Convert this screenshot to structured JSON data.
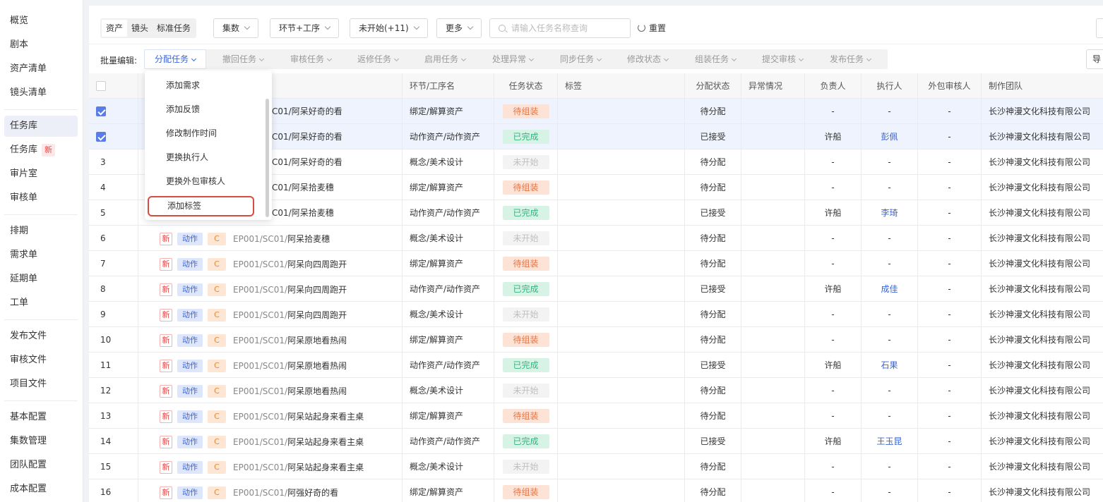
{
  "sidebar": {
    "items": [
      {
        "label": "概览"
      },
      {
        "label": "剧本"
      },
      {
        "label": "资产清单"
      },
      {
        "label": "镜头清单"
      },
      {
        "label": "任务库"
      },
      {
        "label": "任务库",
        "badge": "新"
      },
      {
        "label": "审片室"
      },
      {
        "label": "审核单"
      },
      {
        "label": "排期"
      },
      {
        "label": "需求单"
      },
      {
        "label": "延期单"
      },
      {
        "label": "工单"
      },
      {
        "label": "发布文件"
      },
      {
        "label": "审核文件"
      },
      {
        "label": "项目文件"
      },
      {
        "label": "基本配置"
      },
      {
        "label": "集数管理"
      },
      {
        "label": "团队配置"
      },
      {
        "label": "成本配置"
      }
    ]
  },
  "filters": {
    "segments": [
      "资产",
      "镜头",
      "标准任务"
    ],
    "dropdowns": [
      "集数",
      "环节+工序",
      "未开始(+11)",
      "更多"
    ],
    "search_placeholder": "请输入任务名称查询",
    "reset_label": "重置"
  },
  "batch": {
    "label": "批量编辑:",
    "items": [
      "分配任务",
      "撤回任务",
      "审核任务",
      "返修任务",
      "启用任务",
      "处理异常",
      "同步任务",
      "修改状态",
      "组装任务",
      "提交审核",
      "发布任务"
    ],
    "edge_label": "导"
  },
  "menu": {
    "items": [
      "添加需求",
      "添加反馈",
      "修改制作时间",
      "更换执行人",
      "更换外包审核人",
      "添加标签"
    ]
  },
  "table": {
    "headers": [
      "环节/工序名",
      "任务状态",
      "标签",
      "分配状态",
      "异常情况",
      "负责人",
      "执行人",
      "外包审核人",
      "制作团队"
    ],
    "rows": [
      {
        "idx": "",
        "checked": true,
        "sel": true,
        "path": "C01/阿呆好奇的看",
        "stage": "绑定/解算资产",
        "status": "待组装",
        "skind": "wait",
        "assign": "待分配",
        "owner": "-",
        "exec": "-",
        "review": "-",
        "team": "长沙神漫文化科技有限公司"
      },
      {
        "idx": "",
        "checked": true,
        "sel": true,
        "path": "C01/阿呆好奇的看",
        "stage": "动作资产/动作资产",
        "status": "已完成",
        "skind": "done",
        "assign": "已接受",
        "owner": "许船",
        "exec": "彭佩",
        "review": "-",
        "team": "长沙神漫文化科技有限公司"
      },
      {
        "idx": "3",
        "path": "C01/阿呆好奇的看",
        "stage": "概念/美术设计",
        "status": "未开始",
        "skind": "none",
        "assign": "待分配",
        "owner": "-",
        "exec": "-",
        "review": "-",
        "team": "长沙神漫文化科技有限公司"
      },
      {
        "idx": "4",
        "path": "C01/阿呆拾麦穗",
        "stage": "绑定/解算资产",
        "status": "待组装",
        "skind": "wait",
        "assign": "待分配",
        "owner": "-",
        "exec": "-",
        "review": "-",
        "team": "长沙神漫文化科技有限公司"
      },
      {
        "idx": "5",
        "path": "C01/阿呆拾麦穗",
        "stage": "动作资产/动作资产",
        "status": "已完成",
        "skind": "done",
        "assign": "已接受",
        "owner": "许船",
        "exec": "李琦",
        "review": "-",
        "team": "长沙神漫文化科技有限公司"
      },
      {
        "idx": "6",
        "tags": true,
        "code": "EP001/SC01/",
        "path": "阿呆拾麦穗",
        "stage": "概念/美术设计",
        "status": "未开始",
        "skind": "none",
        "assign": "待分配",
        "owner": "-",
        "exec": "-",
        "review": "-",
        "team": "长沙神漫文化科技有限公司"
      },
      {
        "idx": "7",
        "tags": true,
        "code": "EP001/SC01/",
        "path": "阿呆向四周跑开",
        "stage": "绑定/解算资产",
        "status": "待组装",
        "skind": "wait",
        "assign": "待分配",
        "owner": "-",
        "exec": "-",
        "review": "-",
        "team": "长沙神漫文化科技有限公司"
      },
      {
        "idx": "8",
        "tags": true,
        "code": "EP001/SC01/",
        "path": "阿呆向四周跑开",
        "stage": "动作资产/动作资产",
        "status": "已完成",
        "skind": "done",
        "assign": "已接受",
        "owner": "许船",
        "exec": "成佳",
        "review": "-",
        "team": "长沙神漫文化科技有限公司"
      },
      {
        "idx": "9",
        "tags": true,
        "code": "EP001/SC01/",
        "path": "阿呆向四周跑开",
        "stage": "概念/美术设计",
        "status": "未开始",
        "skind": "none",
        "assign": "待分配",
        "owner": "-",
        "exec": "-",
        "review": "-",
        "team": "长沙神漫文化科技有限公司"
      },
      {
        "idx": "10",
        "tags": true,
        "code": "EP001/SC01/",
        "path": "阿呆原地看热闹",
        "stage": "绑定/解算资产",
        "status": "待组装",
        "skind": "wait",
        "assign": "待分配",
        "owner": "-",
        "exec": "-",
        "review": "-",
        "team": "长沙神漫文化科技有限公司"
      },
      {
        "idx": "11",
        "tags": true,
        "code": "EP001/SC01/",
        "path": "阿呆原地看热闹",
        "stage": "动作资产/动作资产",
        "status": "已完成",
        "skind": "done",
        "assign": "已接受",
        "owner": "许船",
        "exec": "石果",
        "review": "-",
        "team": "长沙神漫文化科技有限公司"
      },
      {
        "idx": "12",
        "tags": true,
        "code": "EP001/SC01/",
        "path": "阿呆原地看热闹",
        "stage": "概念/美术设计",
        "status": "未开始",
        "skind": "none",
        "assign": "待分配",
        "owner": "-",
        "exec": "-",
        "review": "-",
        "team": "长沙神漫文化科技有限公司"
      },
      {
        "idx": "13",
        "tags": true,
        "code": "EP001/SC01/",
        "path": "阿呆站起身来看主桌",
        "stage": "绑定/解算资产",
        "status": "待组装",
        "skind": "wait",
        "assign": "待分配",
        "owner": "-",
        "exec": "-",
        "review": "-",
        "team": "长沙神漫文化科技有限公司"
      },
      {
        "idx": "14",
        "tags": true,
        "code": "EP001/SC01/",
        "path": "阿呆站起身来看主桌",
        "stage": "动作资产/动作资产",
        "status": "已完成",
        "skind": "done",
        "assign": "已接受",
        "owner": "许船",
        "exec": "王玉昆",
        "review": "-",
        "team": "长沙神漫文化科技有限公司"
      },
      {
        "idx": "15",
        "tags": true,
        "code": "EP001/SC01/",
        "path": "阿呆站起身来看主桌",
        "stage": "概念/美术设计",
        "status": "未开始",
        "skind": "none",
        "assign": "待分配",
        "owner": "-",
        "exec": "-",
        "review": "-",
        "team": "长沙神漫文化科技有限公司"
      },
      {
        "idx": "16",
        "tags": true,
        "code": "EP001/SC01/",
        "path": "阿强好奇的看",
        "stage": "绑定/解算资产",
        "status": "待组装",
        "skind": "wait",
        "assign": "待分配",
        "owner": "-",
        "exec": "-",
        "review": "-",
        "team": "长沙神漫文化科技有限公司"
      }
    ],
    "tag_labels": {
      "new": "新",
      "act": "动作",
      "c": "C"
    }
  },
  "colors": {
    "accent": "#3a64d8",
    "highlight": "#d94b3f"
  }
}
